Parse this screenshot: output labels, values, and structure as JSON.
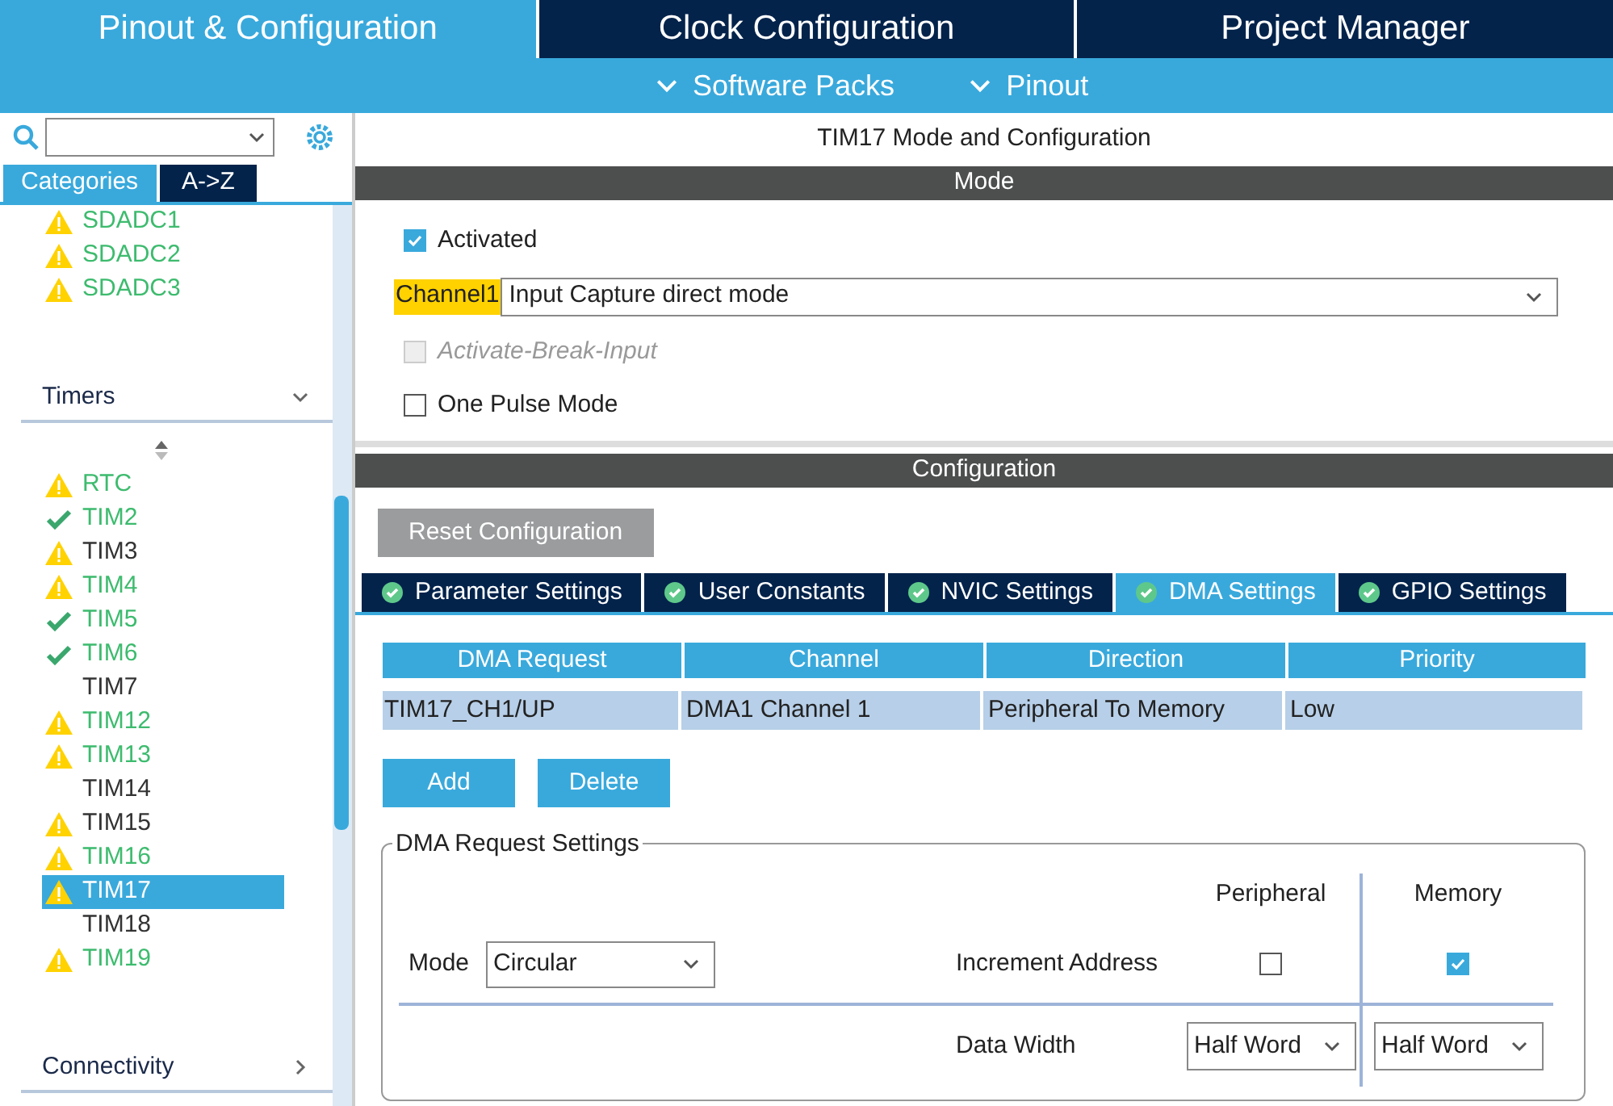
{
  "top_tabs": [
    {
      "label": "Pinout & Configuration",
      "selected": true
    },
    {
      "label": "Clock Configuration",
      "selected": false
    },
    {
      "label": "Project Manager",
      "selected": false
    }
  ],
  "sub_menu": [
    "Software Packs",
    "Pinout"
  ],
  "sidebar": {
    "view_tabs": [
      {
        "label": "Categories",
        "selected": true
      },
      {
        "label": "A->Z",
        "selected": false
      }
    ],
    "groups": [
      {
        "items": [
          {
            "label": "SDADC1",
            "kind": "warning",
            "available": true,
            "selected": false
          },
          {
            "label": "SDADC2",
            "kind": "warning",
            "available": true,
            "selected": false
          },
          {
            "label": "SDADC3",
            "kind": "warning",
            "available": true,
            "selected": false
          }
        ]
      },
      {
        "title": "Timers",
        "expanded": true,
        "items": [
          {
            "label": "RTC",
            "kind": "warning",
            "available": true,
            "selected": false
          },
          {
            "label": "TIM2",
            "kind": "ok",
            "available": true,
            "selected": false
          },
          {
            "label": "TIM3",
            "kind": "warning",
            "available": false,
            "selected": false
          },
          {
            "label": "TIM4",
            "kind": "warning",
            "available": true,
            "selected": false
          },
          {
            "label": "TIM5",
            "kind": "ok",
            "available": true,
            "selected": false
          },
          {
            "label": "TIM6",
            "kind": "ok",
            "available": true,
            "selected": false
          },
          {
            "label": "TIM7",
            "kind": "plain",
            "available": false,
            "selected": false
          },
          {
            "label": "TIM12",
            "kind": "warning",
            "available": true,
            "selected": false
          },
          {
            "label": "TIM13",
            "kind": "warning",
            "available": true,
            "selected": false
          },
          {
            "label": "TIM14",
            "kind": "plain",
            "available": false,
            "selected": false
          },
          {
            "label": "TIM15",
            "kind": "warning",
            "available": false,
            "selected": false
          },
          {
            "label": "TIM16",
            "kind": "warning",
            "available": true,
            "selected": false
          },
          {
            "label": "TIM17",
            "kind": "warning",
            "selected": true
          },
          {
            "label": "TIM18",
            "kind": "plain",
            "available": false,
            "selected": false
          },
          {
            "label": "TIM19",
            "kind": "warning",
            "available": true,
            "selected": false
          }
        ]
      },
      {
        "title": "Connectivity",
        "expanded": false
      }
    ]
  },
  "panel_title": "TIM17 Mode and Configuration",
  "mode": {
    "title": "Mode",
    "options": [
      {
        "kind": "checkbox",
        "label": "Activated",
        "checked": true,
        "disabled": false
      },
      {
        "kind": "select",
        "label": "Channel1",
        "value": "Input Capture direct mode"
      },
      {
        "kind": "checkbox",
        "label": "Activate-Break-Input",
        "checked": false,
        "disabled": true
      },
      {
        "kind": "checkbox",
        "label": "One Pulse Mode",
        "checked": false,
        "disabled": false
      }
    ]
  },
  "configuration": {
    "title": "Configuration",
    "reset_button": "Reset Configuration",
    "tabs": [
      {
        "label": "Parameter Settings",
        "selected": false
      },
      {
        "label": "User Constants",
        "selected": false
      },
      {
        "label": "NVIC Settings",
        "selected": false
      },
      {
        "label": "DMA Settings",
        "selected": true
      },
      {
        "label": "GPIO Settings",
        "selected": false
      }
    ],
    "table": {
      "columns": [
        "DMA Request",
        "Channel",
        "Direction",
        "Priority"
      ],
      "rows": [
        {
          "cells": [
            "TIM17_CH1/UP",
            "DMA1 Channel 1",
            "Peripheral To Memory",
            "Low"
          ],
          "selected": true
        }
      ]
    },
    "buttons": [
      "Add",
      "Delete"
    ],
    "dma_settings": {
      "title": "DMA Request Settings",
      "mode_label": "Mode",
      "mode_value": "Circular",
      "columns": [
        "Peripheral",
        "Memory"
      ],
      "increment_label": "Increment Address",
      "increment": [
        {
          "checked": false
        },
        {
          "checked": true
        }
      ],
      "width_label": "Data Width",
      "width": [
        "Half Word",
        "Half Word"
      ]
    }
  }
}
